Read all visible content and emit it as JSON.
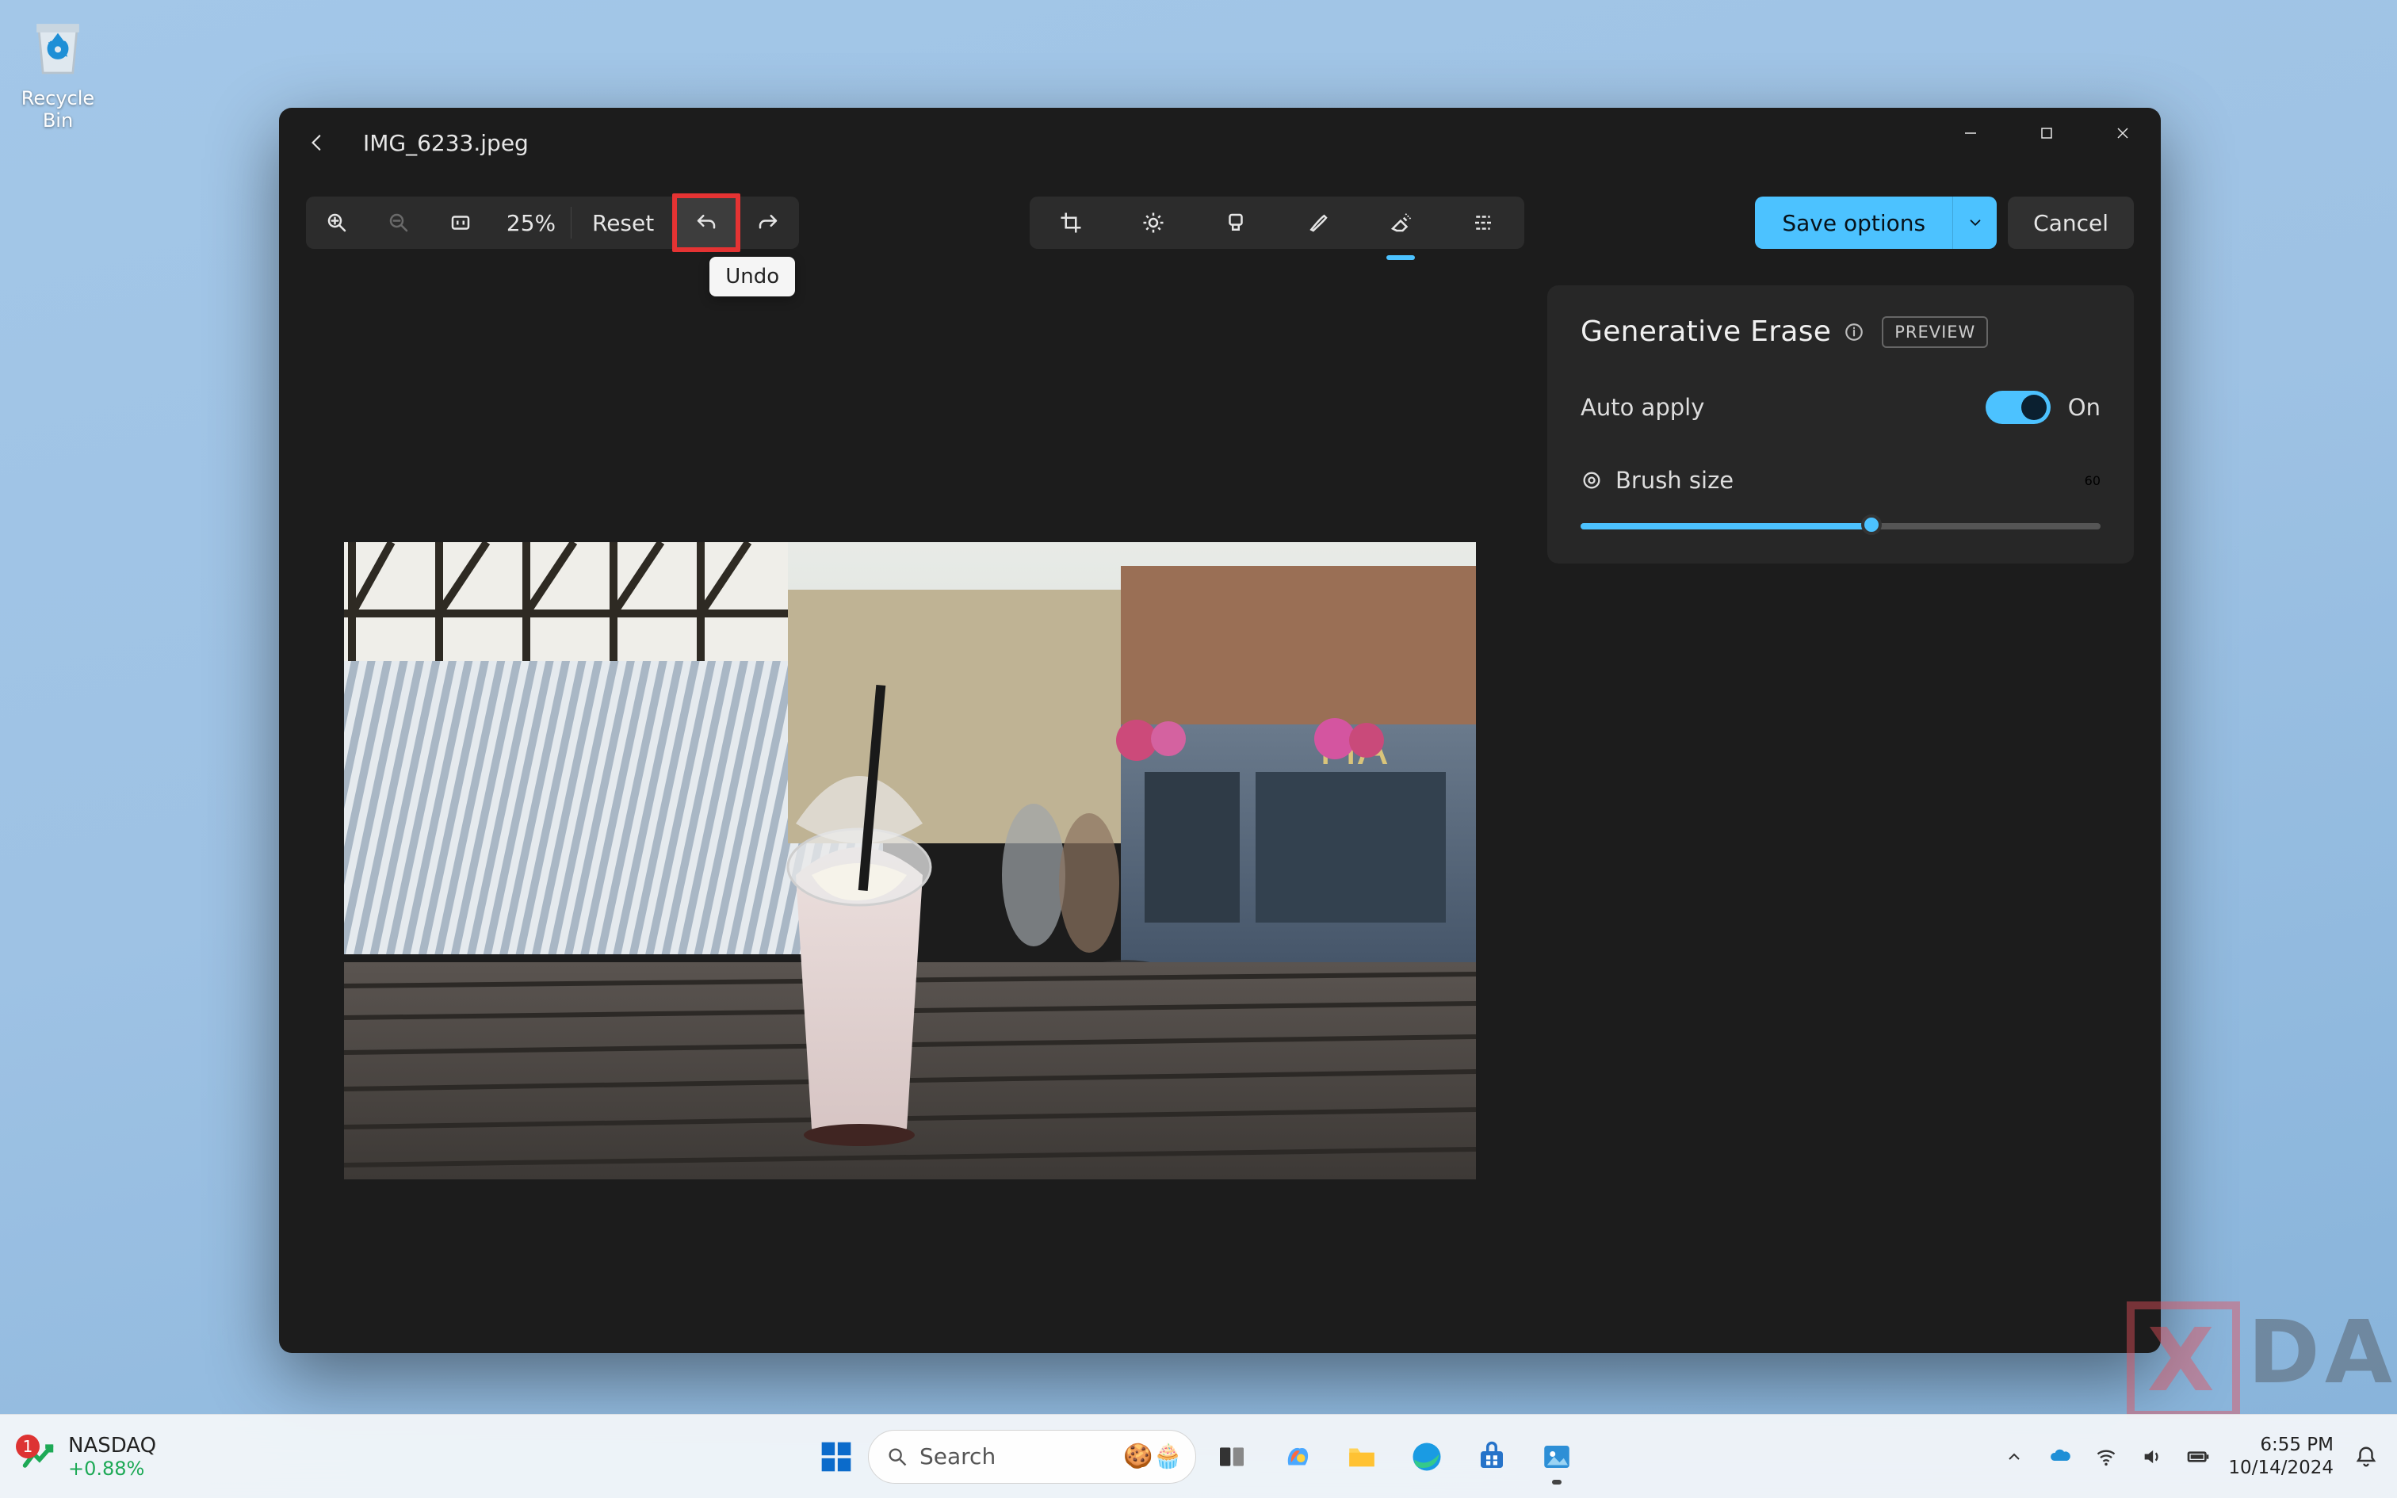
{
  "desktop": {
    "recycle_bin_label": "Recycle Bin"
  },
  "window": {
    "title": "IMG_6233.jpeg"
  },
  "toolbar": {
    "zoom_value": "25%",
    "reset_label": "Reset",
    "undo_tooltip": "Undo",
    "save_options_label": "Save options",
    "cancel_label": "Cancel"
  },
  "panel": {
    "title": "Generative Erase",
    "preview_badge": "PREVIEW",
    "auto_apply_label": "Auto apply",
    "auto_apply_state": "On",
    "brush_size_label": "Brush size",
    "brush_size_value": "60",
    "brush_slider_percent": 56
  },
  "taskbar": {
    "stock": {
      "symbol": "NASDAQ",
      "change_pct": "+0.88%",
      "badge": "1"
    },
    "search_placeholder": "Search",
    "clock_time": "6:55 PM",
    "clock_date": "10/14/2024"
  },
  "watermark": "XDA"
}
